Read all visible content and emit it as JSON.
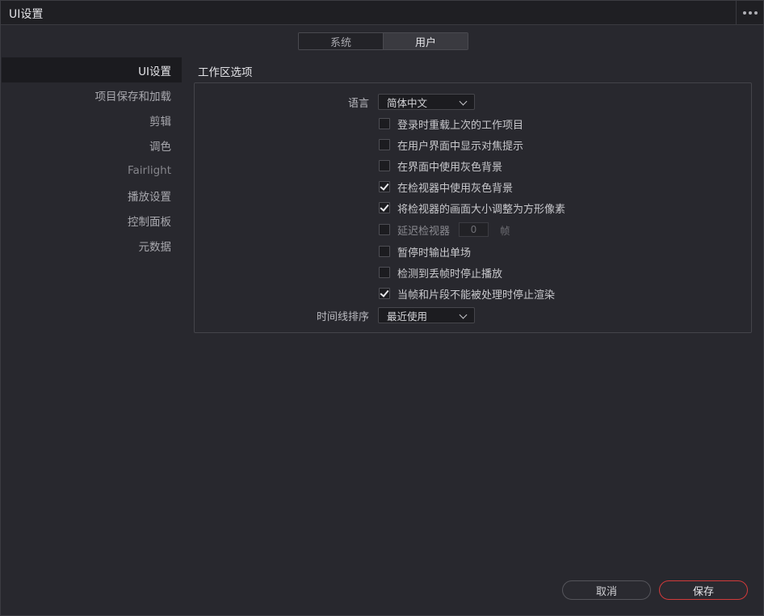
{
  "window": {
    "title": "UI设置"
  },
  "tabs": [
    {
      "label": "系统",
      "active": false
    },
    {
      "label": "用户",
      "active": true
    }
  ],
  "sidebar": {
    "items": [
      {
        "label": "UI设置",
        "active": true
      },
      {
        "label": "项目保存和加载"
      },
      {
        "label": "剪辑"
      },
      {
        "label": "调色"
      },
      {
        "label": "Fairlight"
      },
      {
        "label": "播放设置"
      },
      {
        "label": "控制面板"
      },
      {
        "label": "元数据"
      }
    ]
  },
  "workspace": {
    "title": "工作区选项",
    "language": {
      "label": "语言",
      "value": "简体中文"
    },
    "options": [
      {
        "label": "登录时重载上次的工作项目",
        "checked": false
      },
      {
        "label": "在用户界面中显示对焦提示",
        "checked": false
      },
      {
        "label": "在界面中使用灰色背景",
        "checked": false
      },
      {
        "label": "在检视器中使用灰色背景",
        "checked": true
      },
      {
        "label": "将检视器的画面大小调整为方形像素",
        "checked": true
      },
      {
        "label": "延迟检视器",
        "checked": false,
        "value": "0",
        "unit": "帧"
      },
      {
        "label": "暂停时输出单场",
        "checked": false
      },
      {
        "label": "检测到丢帧时停止播放",
        "checked": false
      },
      {
        "label": "当帧和片段不能被处理时停止渲染",
        "checked": true
      }
    ],
    "timeline_sort": {
      "label": "时间线排序",
      "value": "最近使用"
    }
  },
  "footer": {
    "cancel_label": "取消",
    "save_label": "保存"
  },
  "colors": {
    "accent_save_border": "#d23a3a",
    "panel_bg": "#28282e"
  }
}
